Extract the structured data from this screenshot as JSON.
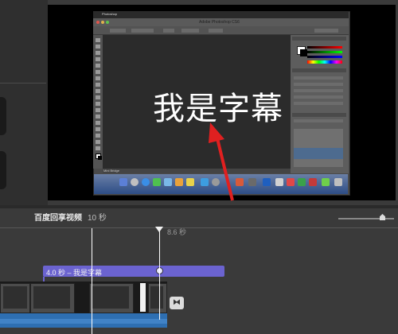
{
  "photoshop": {
    "menu_app": "Photoshop",
    "document_title": "Adobe Photoshop CS6",
    "status_label": "Mini Bridge",
    "canvas_text": "我是字幕"
  },
  "timeline": {
    "project_title": "百度回享视频",
    "project_duration": "10 秒",
    "skimmer_time": "8.6 秒",
    "title_clip_label": "4.0 秒 – 我是字幕",
    "transition_icon": "⧓"
  },
  "colors": {
    "background": "#3a3a3a",
    "title_clip": "#6b63d0",
    "audio": "#2e6fb2",
    "arrow": "#e02020"
  }
}
